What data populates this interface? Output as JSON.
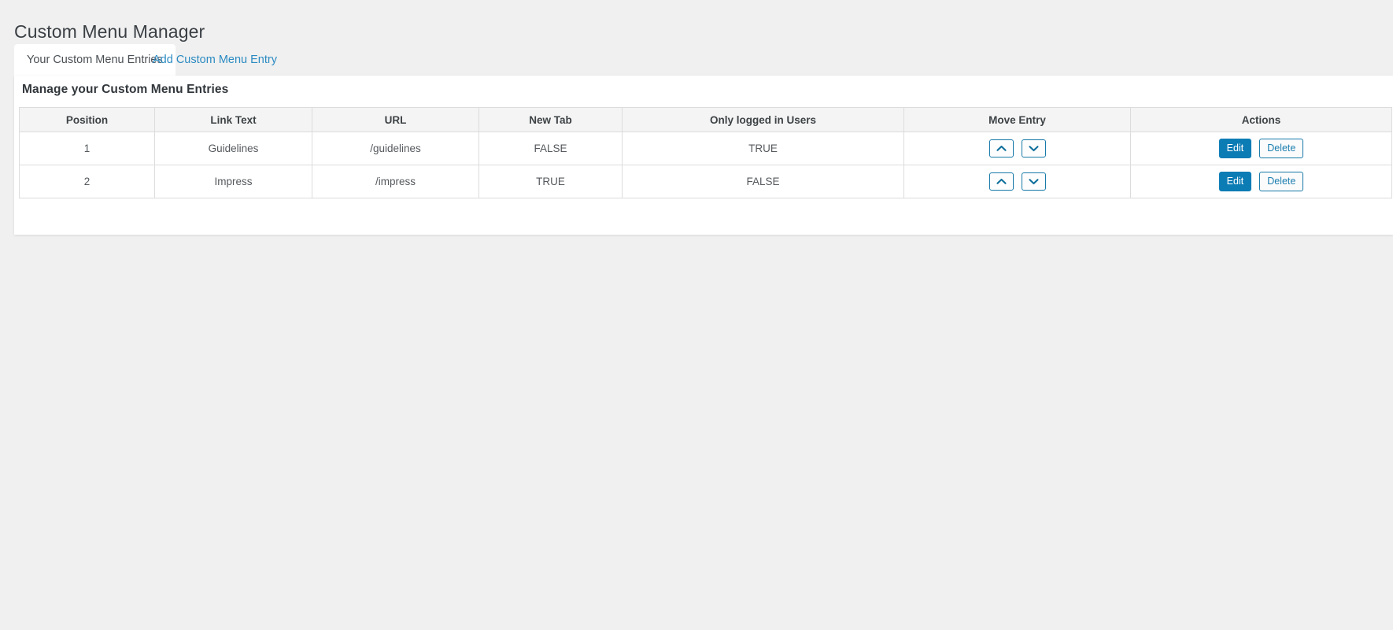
{
  "page": {
    "title": "Custom Menu Manager"
  },
  "tabs": [
    {
      "label": "Your Custom Menu Entries",
      "active": true
    },
    {
      "label": "Add Custom Menu Entry",
      "active": false
    }
  ],
  "panel": {
    "heading": "Manage your Custom Menu Entries"
  },
  "table": {
    "columns": [
      "Position",
      "Link Text",
      "URL",
      "New Tab",
      "Only logged in Users",
      "Move Entry",
      "Actions"
    ],
    "rows": [
      {
        "position": "1",
        "link_text": "Guidelines",
        "url": "/guidelines",
        "new_tab": "FALSE",
        "only_logged_in_users": "TRUE",
        "move_up_label": "Move up",
        "move_down_label": "Move down",
        "edit_label": "Edit",
        "delete_label": "Delete"
      },
      {
        "position": "2",
        "link_text": "Impress",
        "url": "/impress",
        "new_tab": "TRUE",
        "only_logged_in_users": "FALSE",
        "move_up_label": "Move up",
        "move_down_label": "Move down",
        "edit_label": "Edit",
        "delete_label": "Delete"
      }
    ]
  },
  "icons": {
    "move_up": "chevron-up-icon",
    "move_down": "chevron-down-icon"
  },
  "colors": {
    "page_background": "#f0f0f0",
    "card_background": "#ffffff",
    "accent_blue": "#0c7cb5",
    "link_blue": "#2b8bc2",
    "border_gray": "#dcdcdc",
    "header_row": "#f4f4f4",
    "text_dark": "#3a3f44"
  }
}
